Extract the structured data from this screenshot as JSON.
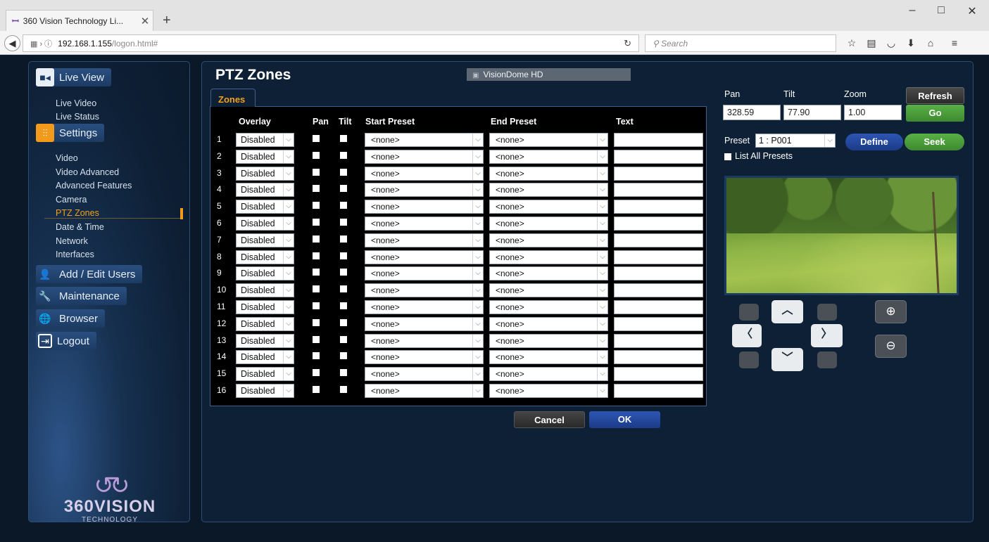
{
  "browser": {
    "tab_title": "360 Vision Technology Li...",
    "tab_close": "✕",
    "new_tab": "+",
    "url_host": "192.168.1.155",
    "url_path": "/logon.html#",
    "search_placeholder": "Search",
    "window_minimize": "–",
    "window_maximize": "□",
    "window_close": "✕"
  },
  "sidebar": {
    "live_view": "Live View",
    "live_view_items": [
      "Live Video",
      "Live Status"
    ],
    "settings": "Settings",
    "settings_items": [
      "Video",
      "Video Advanced",
      "Advanced Features",
      "Camera",
      "PTZ Zones",
      "Date & Time",
      "Network",
      "Interfaces"
    ],
    "active_item": "PTZ Zones",
    "add_edit_users": "Add / Edit Users",
    "maintenance": "Maintenance",
    "browser": "Browser",
    "logout": "Logout",
    "logo_text": "360VISION",
    "logo_sub": "TECHNOLOGY"
  },
  "header": {
    "title": "PTZ Zones",
    "device": "VisionDome HD"
  },
  "zones": {
    "tab_label": "Zones",
    "columns": [
      "Overlay",
      "Pan",
      "Tilt",
      "Start Preset",
      "End Preset",
      "Text"
    ],
    "rows": [
      {
        "num": "1",
        "overlay": "Disabled",
        "start": "<none>",
        "end": "<none>",
        "text": ""
      },
      {
        "num": "2",
        "overlay": "Disabled",
        "start": "<none>",
        "end": "<none>",
        "text": ""
      },
      {
        "num": "3",
        "overlay": "Disabled",
        "start": "<none>",
        "end": "<none>",
        "text": ""
      },
      {
        "num": "4",
        "overlay": "Disabled",
        "start": "<none>",
        "end": "<none>",
        "text": ""
      },
      {
        "num": "5",
        "overlay": "Disabled",
        "start": "<none>",
        "end": "<none>",
        "text": ""
      },
      {
        "num": "6",
        "overlay": "Disabled",
        "start": "<none>",
        "end": "<none>",
        "text": ""
      },
      {
        "num": "7",
        "overlay": "Disabled",
        "start": "<none>",
        "end": "<none>",
        "text": ""
      },
      {
        "num": "8",
        "overlay": "Disabled",
        "start": "<none>",
        "end": "<none>",
        "text": ""
      },
      {
        "num": "9",
        "overlay": "Disabled",
        "start": "<none>",
        "end": "<none>",
        "text": ""
      },
      {
        "num": "10",
        "overlay": "Disabled",
        "start": "<none>",
        "end": "<none>",
        "text": ""
      },
      {
        "num": "11",
        "overlay": "Disabled",
        "start": "<none>",
        "end": "<none>",
        "text": ""
      },
      {
        "num": "12",
        "overlay": "Disabled",
        "start": "<none>",
        "end": "<none>",
        "text": ""
      },
      {
        "num": "13",
        "overlay": "Disabled",
        "start": "<none>",
        "end": "<none>",
        "text": ""
      },
      {
        "num": "14",
        "overlay": "Disabled",
        "start": "<none>",
        "end": "<none>",
        "text": ""
      },
      {
        "num": "15",
        "overlay": "Disabled",
        "start": "<none>",
        "end": "<none>",
        "text": ""
      },
      {
        "num": "16",
        "overlay": "Disabled",
        "start": "<none>",
        "end": "<none>",
        "text": ""
      }
    ],
    "cancel_label": "Cancel",
    "ok_label": "OK"
  },
  "ptz": {
    "pan_label": "Pan",
    "tilt_label": "Tilt",
    "zoom_label": "Zoom",
    "pan_value": "328.59",
    "tilt_value": "77.90",
    "zoom_value": "1.00",
    "refresh_label": "Refresh",
    "go_label": "Go",
    "preset_label": "Preset",
    "preset_value": "1 : P001",
    "define_label": "Define",
    "seek_label": "Seek",
    "list_all_label": "List All Presets"
  },
  "colors": {
    "accent_orange": "#f3a21b",
    "go_green": "#59b046",
    "ok_blue": "#2d56b3",
    "panel_bg": "#0e2036"
  }
}
